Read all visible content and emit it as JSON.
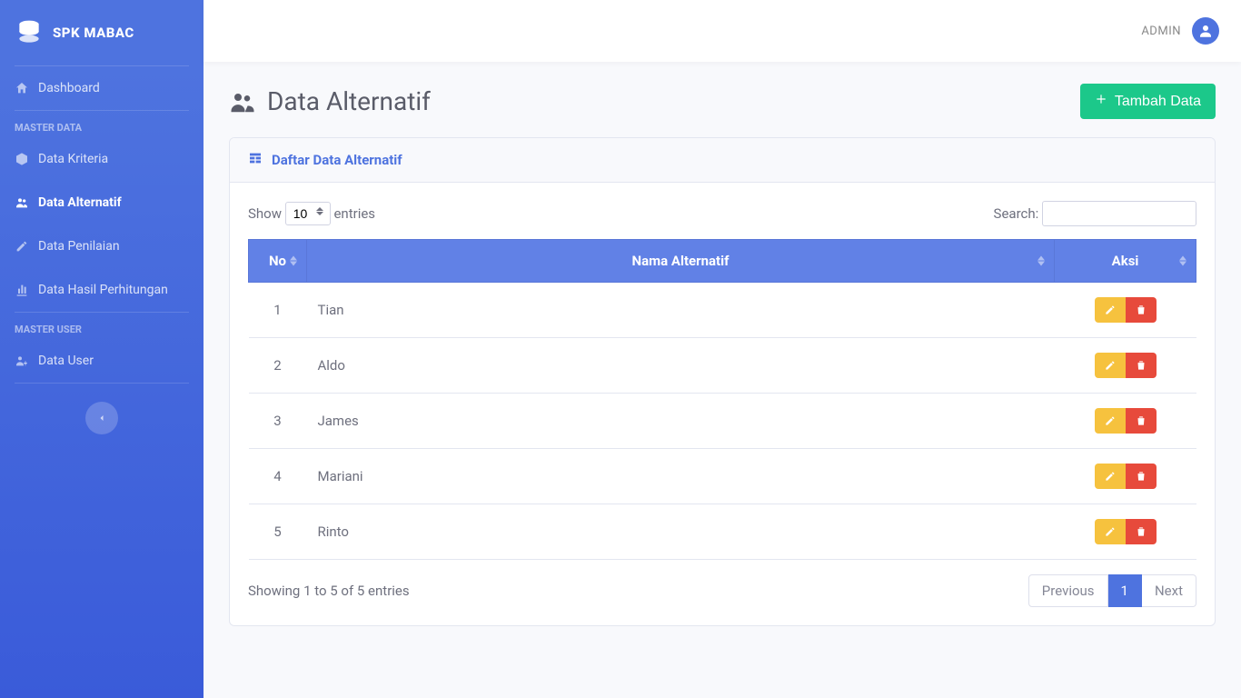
{
  "brand": {
    "title": "SPK MABAC"
  },
  "topbar": {
    "username": "ADMIN"
  },
  "sidebar": {
    "dashboard": "Dashboard",
    "heading_master_data": "MASTER DATA",
    "heading_master_user": "MASTER USER",
    "items": {
      "kriteria": "Data Kriteria",
      "alternatif": "Data Alternatif",
      "penilaian": "Data Penilaian",
      "hasil": "Data Hasil Perhitungan",
      "user": "Data User"
    }
  },
  "page": {
    "title": "Data Alternatif",
    "add_button": "Tambah Data",
    "card_title": "Daftar Data Alternatif"
  },
  "table": {
    "show_label": "Show",
    "entries_label": "entries",
    "page_size": "10",
    "search_label": "Search:",
    "headers": {
      "no": "No",
      "nama": "Nama Alternatif",
      "aksi": "Aksi"
    },
    "rows": [
      {
        "no": "1",
        "nama": "Tian"
      },
      {
        "no": "2",
        "nama": "Aldo"
      },
      {
        "no": "3",
        "nama": "James"
      },
      {
        "no": "4",
        "nama": "Mariani"
      },
      {
        "no": "5",
        "nama": "Rinto"
      }
    ],
    "info": "Showing 1 to 5 of 5 entries",
    "pagination": {
      "prev": "Previous",
      "current": "1",
      "next": "Next"
    }
  }
}
